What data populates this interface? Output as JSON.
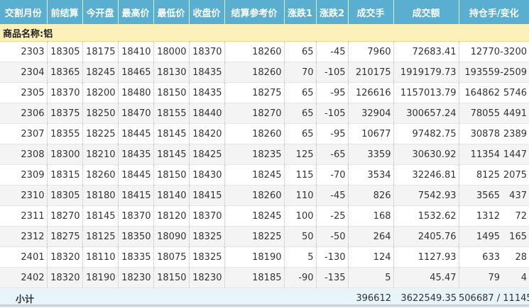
{
  "headers": [
    "交割月份",
    "前结算",
    "今开盘",
    "最高价",
    "最低价",
    "收盘价",
    "结算参考价",
    "涨跌1",
    "涨跌2",
    "成交手",
    "成交额",
    "持仓手/变化"
  ],
  "group_label": "商品名称:铝",
  "rows": [
    [
      "2303",
      "18305",
      "18175",
      "18410",
      "18000",
      "18370",
      "18260",
      "65",
      "-45",
      "7960",
      "72683.41",
      "12770",
      "-3200"
    ],
    [
      "2304",
      "18365",
      "18245",
      "18465",
      "18130",
      "18435",
      "18260",
      "70",
      "-105",
      "210175",
      "1919179.73",
      "193559",
      "-2509"
    ],
    [
      "2305",
      "18370",
      "18200",
      "18480",
      "18150",
      "18435",
      "18275",
      "65",
      "-95",
      "126616",
      "1157013.79",
      "164862",
      "5746"
    ],
    [
      "2306",
      "18375",
      "18250",
      "18470",
      "18155",
      "18440",
      "18270",
      "65",
      "-105",
      "32904",
      "300657.24",
      "78055",
      "4491"
    ],
    [
      "2307",
      "18355",
      "18225",
      "18445",
      "18145",
      "18420",
      "18260",
      "65",
      "-95",
      "10677",
      "97482.75",
      "30878",
      "2389"
    ],
    [
      "2308",
      "18300",
      "18210",
      "18435",
      "18145",
      "18425",
      "18235",
      "125",
      "-65",
      "3359",
      "30630.92",
      "11354",
      "1447"
    ],
    [
      "2309",
      "18315",
      "18260",
      "18445",
      "18150",
      "18430",
      "18245",
      "115",
      "-70",
      "3534",
      "32246.81",
      "8125",
      "2075"
    ],
    [
      "2310",
      "18305",
      "18180",
      "18415",
      "18140",
      "18415",
      "18260",
      "110",
      "-45",
      "826",
      "7542.93",
      "3565",
      "437"
    ],
    [
      "2311",
      "18270",
      "18145",
      "18370",
      "18120",
      "18370",
      "18245",
      "100",
      "-25",
      "168",
      "1532.62",
      "1312",
      "72"
    ],
    [
      "2312",
      "18275",
      "18125",
      "18350",
      "18090",
      "18325",
      "18225",
      "50",
      "-50",
      "264",
      "2405.76",
      "1495",
      "165"
    ],
    [
      "2401",
      "18320",
      "18110",
      "18335",
      "18075",
      "18325",
      "18190",
      "5",
      "-130",
      "124",
      "1127.93",
      "633",
      "28"
    ],
    [
      "2402",
      "18320",
      "18190",
      "18230",
      "18150",
      "18230",
      "18185",
      "-90",
      "-135",
      "5",
      "45.47",
      "79",
      "4"
    ]
  ],
  "total": {
    "label": "小计",
    "volume": "396612",
    "turnover": "3622549.35",
    "open_interest": "506687 / 11145"
  }
}
